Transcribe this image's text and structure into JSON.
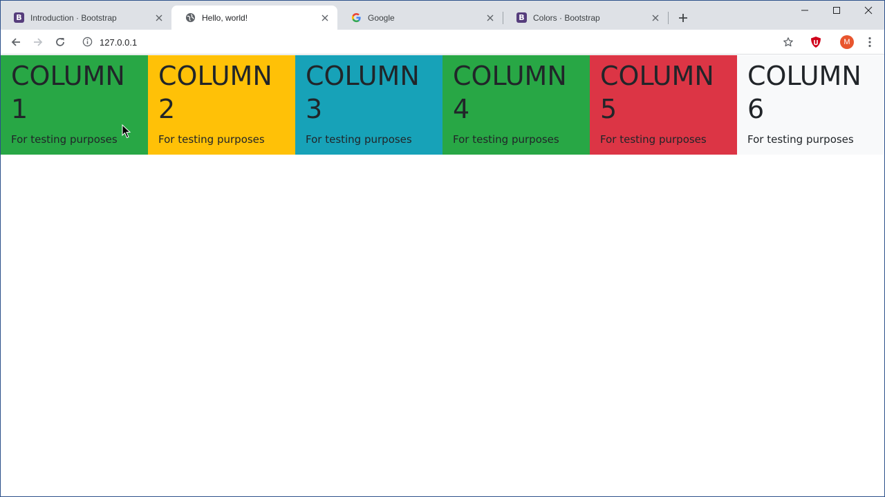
{
  "browser": {
    "tabs": [
      {
        "title": "Introduction · Bootstrap",
        "icon": "bootstrap-icon",
        "active": false
      },
      {
        "title": "Hello, world!",
        "icon": "globe-icon",
        "active": true
      },
      {
        "title": "Google",
        "icon": "google-icon",
        "active": false
      },
      {
        "title": "Colors · Bootstrap",
        "icon": "bootstrap-icon",
        "active": false
      }
    ],
    "favicon_letter": "B",
    "address": "127.0.0.1",
    "profile_initial": "M"
  },
  "columns": [
    {
      "heading_word": "COLUMN",
      "heading_number": "1",
      "text": "For testing purposes",
      "color": "#28a745"
    },
    {
      "heading_word": "COLUMN",
      "heading_number": "2",
      "text": "For testing purposes",
      "color": "#ffc107"
    },
    {
      "heading_word": "COLUMN",
      "heading_number": "3",
      "text": "For testing purposes",
      "color": "#17a2b8"
    },
    {
      "heading_word": "COLUMN",
      "heading_number": "4",
      "text": "For testing purposes",
      "color": "#28a745"
    },
    {
      "heading_word": "COLUMN",
      "heading_number": "5",
      "text": "For testing purposes",
      "color": "#dc3545"
    },
    {
      "heading_word": "COLUMN",
      "heading_number": "6",
      "text": "For testing purposes",
      "color": "#f8f9fa"
    }
  ]
}
